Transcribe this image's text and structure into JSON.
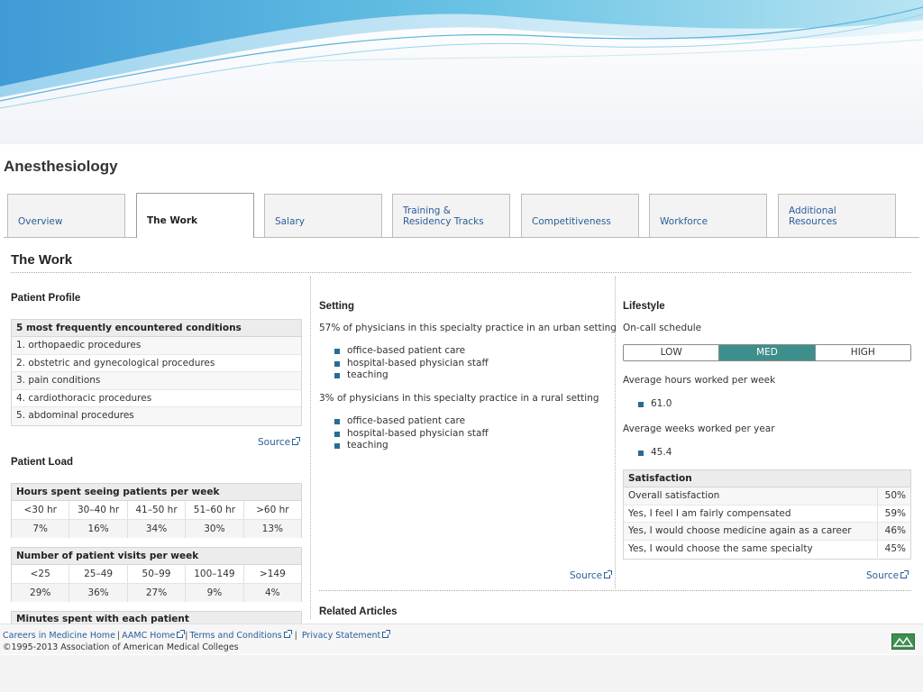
{
  "page": {
    "title": "Anesthesiology"
  },
  "tabs": [
    {
      "label": "Overview"
    },
    {
      "label": "The Work"
    },
    {
      "label": "Salary"
    },
    {
      "label": "Training &\nResidency Tracks"
    },
    {
      "label": "Competitiveness"
    },
    {
      "label": "Workforce"
    },
    {
      "label": "Additional\nResources"
    }
  ],
  "active_tab": "The Work",
  "section": {
    "title": "The Work"
  },
  "patient_profile": {
    "title": "Patient Profile",
    "table_header": "5 most frequently encountered conditions",
    "conditions": [
      "1. orthopaedic procedures",
      "2. obstetric and gynecological procedures",
      "3. pain conditions",
      "4. cardiothoracic procedures",
      "5. abdominal procedures"
    ],
    "source": "Source"
  },
  "patient_load": {
    "title": "Patient Load",
    "hours": {
      "header": "Hours spent seeing patients per week",
      "labels": [
        "<30 hr",
        "30–40 hr",
        "41–50 hr",
        "51–60 hr",
        ">60 hr"
      ],
      "values": [
        "7%",
        "16%",
        "34%",
        "30%",
        "13%"
      ]
    },
    "visits": {
      "header": "Number of patient visits per week",
      "labels": [
        "<25",
        "25–49",
        "50–99",
        "100–149",
        ">149"
      ],
      "values": [
        "29%",
        "36%",
        "27%",
        "9%",
        "4%"
      ]
    },
    "minutes": {
      "header": "Minutes spent with each patient"
    }
  },
  "setting": {
    "title": "Setting",
    "urban_text": "57% of physicians in this specialty practice in an urban setting",
    "urban_items": [
      "office-based patient care",
      "hospital-based physician staff",
      "teaching"
    ],
    "rural_text": "3% of physicians in this specialty practice in a rural setting",
    "rural_items": [
      "office-based patient care",
      "hospital-based physician staff",
      "teaching"
    ],
    "source": "Source"
  },
  "lifestyle": {
    "title": "Lifestyle",
    "oncall_label": "On-call schedule",
    "oncall_options": [
      "LOW",
      "MED",
      "HIGH"
    ],
    "oncall_selected": "MED",
    "hours_label": "Average hours worked per week",
    "hours_value": "61.0",
    "weeks_label": "Average weeks worked per year",
    "weeks_value": "45.4",
    "satisfaction": {
      "header": "Satisfaction",
      "rows": [
        {
          "label": "Overall satisfaction",
          "value": "50%"
        },
        {
          "label": "Yes, I feel I am fairly compensated",
          "value": "59%"
        },
        {
          "label": "Yes, I would choose medicine again as a career",
          "value": "46%"
        },
        {
          "label": "Yes, I would choose the same specialty",
          "value": "45%"
        }
      ]
    },
    "source": "Source"
  },
  "related": {
    "title": "Related Articles"
  },
  "footer": {
    "link_home": "Careers in Medicine Home",
    "link_aamc": "AAMC Home",
    "link_terms": "Terms and Conditions",
    "link_privacy": "Privacy Statement",
    "copyright": "©1995-2013 Association of American Medical Colleges"
  },
  "colors": {
    "accent": "#3d8f8c",
    "link": "#2a5d9a",
    "bullet": "#2a6a95"
  }
}
